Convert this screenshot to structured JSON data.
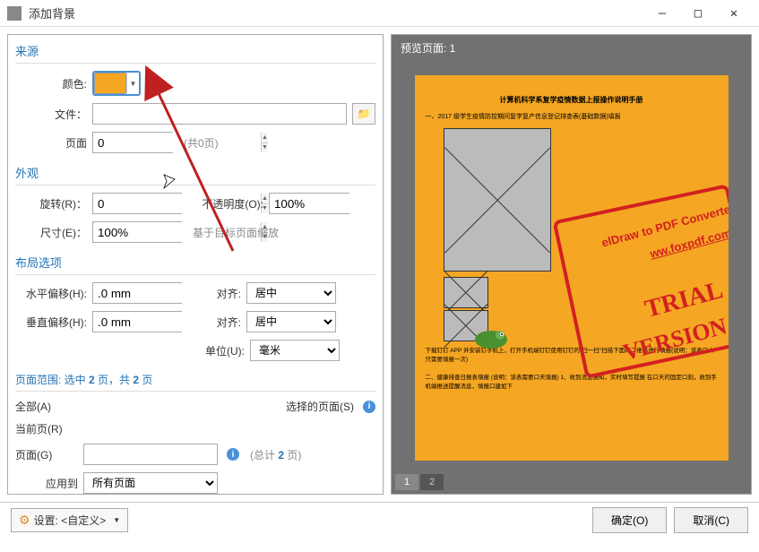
{
  "window": {
    "title": "添加背景",
    "minimize": "—",
    "maximize": "□",
    "close": "✕"
  },
  "source": {
    "title": "来源",
    "color_label": "颜色:",
    "file_label": "文件：",
    "page_label": "页面",
    "page_value": "0",
    "page_total": "(共0页)"
  },
  "appearance": {
    "title": "外观",
    "rotate_label": "旋转(R)：",
    "rotate_value": "0",
    "opacity_label": "不透明度(O):",
    "opacity_value": "100%",
    "scale_label": "尺寸(E)：",
    "scale_value": "100%",
    "scale_hint": "基于目标页面缩放"
  },
  "layout": {
    "title": "布局选项",
    "hoffset_label": "水平偏移(H):",
    "hoffset_value": ".0 mm",
    "voffset_label": "垂直偏移(H):",
    "voffset_value": ".0 mm",
    "align_label": "对齐:",
    "align_value": "居中",
    "unit_label": "单位(U):",
    "unit_value": "毫米"
  },
  "pagerange": {
    "title_prefix": "页面范围: 选中 ",
    "title_mid": " 页，共 ",
    "title_suffix": " 页",
    "selected": "2",
    "total": "2",
    "all": "全部(A)",
    "current": "当前页(R)",
    "pages": "页面(G)",
    "selected_pages": "选择的页面(S)",
    "pages_total_prefix": "(总计 ",
    "pages_total_suffix": " 页)",
    "pages_total": "2",
    "apply_label": "应用到",
    "apply_value": "所有页面"
  },
  "preview": {
    "header": "预览页面: 1",
    "tab1": "1",
    "tab2": "2",
    "doc_title": "计算机科学系复学疫情数据上报操作说明手册",
    "doc_line1": "一、2017 级学生疫情防控期间复学复产信息登记排查表(基础数据)填报",
    "doc_line2": "下载钉钉 APP 并安装钉手机上，打开手机端钉钉使用钉钉的\"扫一扫\"扫描下面的二维码进行填报(说明：该表口人只需要填报一次)",
    "doc_line3": "二、健康排查日报表填报 (说明：该表需要口天填报) 1、收到消息通知，实时填写提报 在口天的固定口刻，收到手机端推送提醒消息，填报口建如下",
    "wm_converter": "elDraw to PDF Converter",
    "wm_url": "ww.foxpdf.com",
    "wm_trial": "TRIAL",
    "wm_version": "VERSION"
  },
  "footer": {
    "settings_label": "设置: <自定义>",
    "ok": "确定(O)",
    "cancel": "取消(C)"
  },
  "colors": {
    "accent": "#f5a623",
    "link": "#2574b5"
  }
}
